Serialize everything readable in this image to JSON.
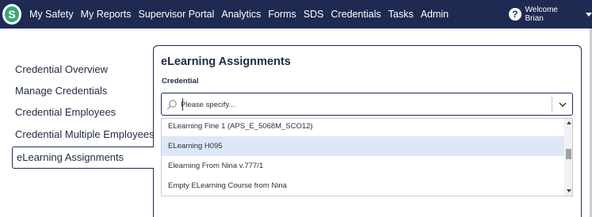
{
  "nav": {
    "logo_letter": "S",
    "items": [
      "My Safety",
      "My Reports",
      "Supervisor Portal",
      "Analytics",
      "Forms",
      "SDS",
      "Credentials",
      "Tasks",
      "Admin"
    ],
    "welcome": "Welcome Brian"
  },
  "sidebar": {
    "items": [
      "Credential Overview",
      "Manage Credentials",
      "Credential Employees",
      "Credential Multiple Employees",
      "eLearning Assignments"
    ],
    "active": "eLearning Assignments"
  },
  "main": {
    "title": "eLearning Assignments",
    "field_label": "Credential",
    "select": {
      "placeholder": "Please specify...",
      "value": ""
    },
    "options": [
      "ELearning Fine 1 (APS_E_5068M_SCO12)",
      "ELearning H095",
      "Elearning From Nina v.777/1",
      "Empty ELearning Course from Nina"
    ],
    "highlighted_option_index": 1
  },
  "colors": {
    "navbar": "#1e2a52",
    "highlight": "#dde8f7",
    "logo_green": "#3aa57a"
  },
  "icons": [
    "logo-icon",
    "help-icon",
    "caret-down-icon",
    "search-icon",
    "chevron-down-icon",
    "scroll-up-arrow-icon",
    "scroll-down-arrow-icon"
  ]
}
